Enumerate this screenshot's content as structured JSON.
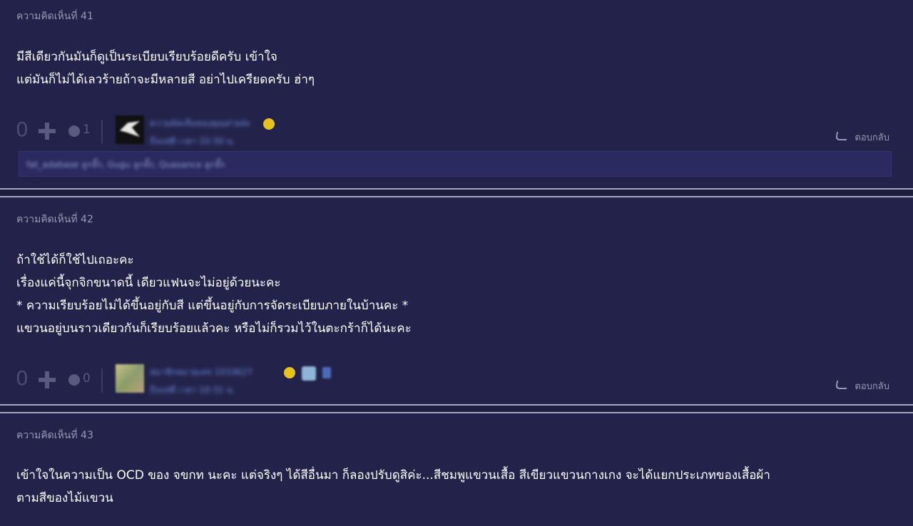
{
  "comments": [
    {
      "number_label": "ความคิดเห็นที่ 41",
      "body_lines": [
        "มีสีเดียวกันมันก็ดูเป็นระเบียบเรียบร้อยดีครับ เข้าใจ",
        "แต่มันก็ไม่ได้เลวร้ายถ้าจะมีหลายสี อย่าไปเครียดครับ ฮ่าๆ"
      ],
      "vote_count": "0",
      "emotion_count": "1",
      "user_name": "ความคิดเห็นของคุณสายส่ง",
      "posted_time": "ถึงแท่ดี เวลา 10:30 น.",
      "reply_label": "ตอบกลับ",
      "likers": "fat_adabase ลูกจั๊ก, Gugu ลูกจั๊ก, Quasance ลูกจั๊ก"
    },
    {
      "number_label": "ความคิดเห็นที่ 42",
      "body_lines": [
        "ถ้าใช้ได้ก็ใช้ไปเถอะคะ",
        "เรื่องแค่นี้จุกจิกขนาดนี้ เดียวแฟนจะไม่อยู่ด้วยนะคะ",
        "* ความเรียบร้อยไม่ได้ขึ้นอยู่กับสี แต่ขึ้นอยู่กับการจัดระเบียบภายในบ้านคะ *",
        "แขวนอยู่บนราวเดียวกันก็เรียบร้อยแล้วคะ หรือไม่ก็รวมไว้ในตะกร้าก็ได้นะคะ"
      ],
      "vote_count": "0",
      "emotion_count": "0",
      "user_name": "สมาชิกหมายเลข 1033627",
      "posted_time": "ถึงแท่ดี เวลา 10:31 น.",
      "reply_label": "ตอบกลับ"
    },
    {
      "number_label": "ความคิดเห็นที่ 43",
      "body_lines": [
        "เข้าใจในความเป็น OCD ของ จขกท นะคะ แต่จริงๆ ได้สีอื่นมา ก็ลองปรับดูสิค่ะ...สีชมพูแขวนเสื้อ สีเขียวแขวนกางเกง จะได้แยกประเภทของเสื้อผ้า",
        "ตามสีของไม้แขวน"
      ]
    }
  ]
}
